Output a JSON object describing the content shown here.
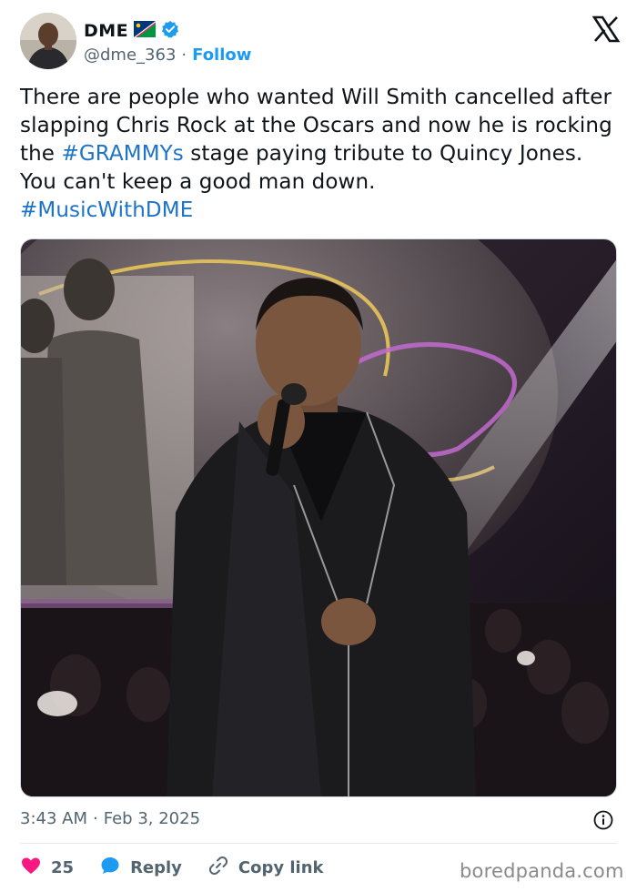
{
  "user": {
    "name": "DME",
    "handle": "@dme_363",
    "separator": "·",
    "follow_label": "Follow"
  },
  "tweet": {
    "text_1": "There are people who wanted Will Smith cancelled after slapping Chris Rock at the Oscars and now he is rocking the ",
    "hashtag_1": "#GRAMMYs",
    "text_2": "  stage paying tribute to Quincy Jones. You can't keep a good man down.",
    "hashtag_2": "#MusicWithDME"
  },
  "meta": {
    "time": "3:43 AM",
    "separator": "·",
    "date": "Feb 3, 2025"
  },
  "actions": {
    "likes": "25",
    "reply_label": "Reply",
    "copy_link_label": "Copy link"
  },
  "watermark": "boredpanda.com",
  "colors": {
    "link_blue": "#1d9bf0",
    "hashtag_blue": "#1d73c9",
    "heart_red": "#f91880",
    "reply_blue": "#1d9bf0",
    "secondary_text": "#536471"
  },
  "icons": {
    "verified": "verified-badge-icon",
    "flag": "namibia-flag-icon",
    "x": "x-logo-icon",
    "info": "info-icon",
    "like": "heart-icon",
    "reply": "speech-bubble-icon",
    "copy_link": "link-icon"
  }
}
